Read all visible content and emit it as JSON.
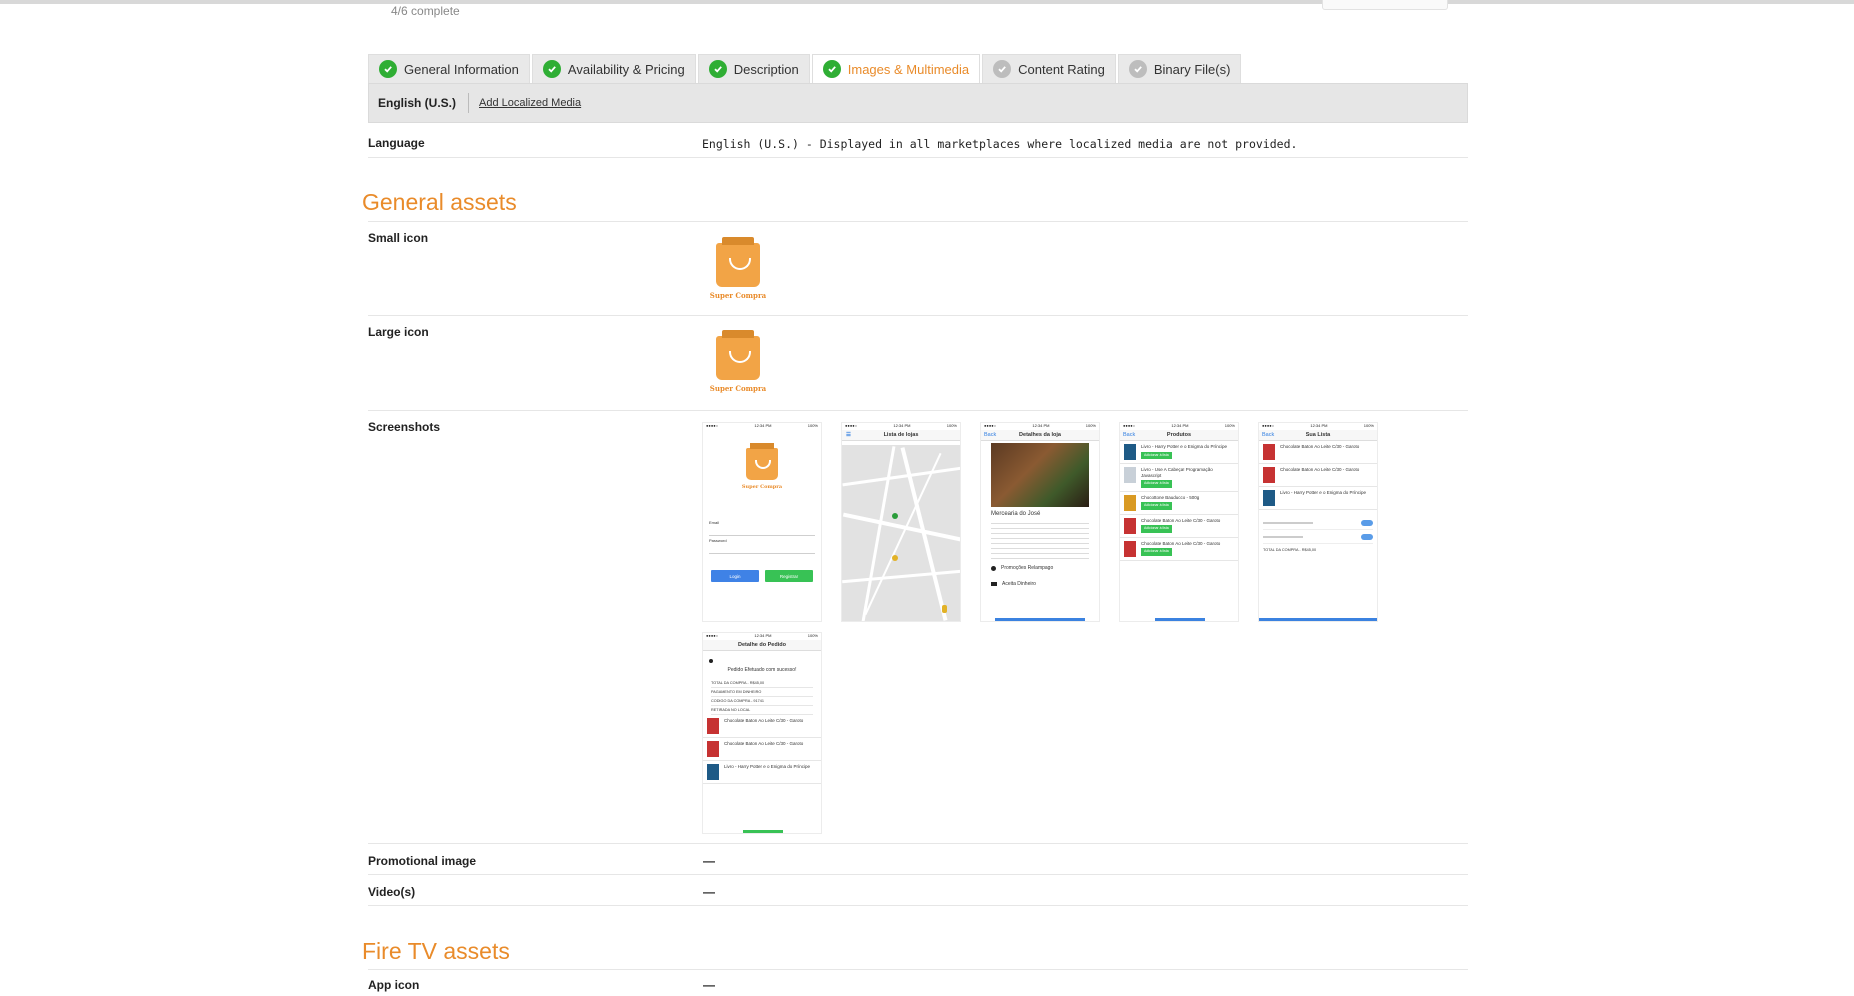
{
  "header": {
    "progress_text": "4/6 complete"
  },
  "tabs": [
    {
      "label": "General Information",
      "status": "complete"
    },
    {
      "label": "Availability & Pricing",
      "status": "complete"
    },
    {
      "label": "Description",
      "status": "complete"
    },
    {
      "label": "Images & Multimedia",
      "status": "complete",
      "active": true
    },
    {
      "label": "Content Rating",
      "status": "incomplete"
    },
    {
      "label": "Binary File(s)",
      "status": "incomplete"
    }
  ],
  "subbar": {
    "language_tab": "English (U.S.)",
    "add_localized_link": "Add Localized Media"
  },
  "language_row": {
    "label": "Language",
    "value": "English (U.S.) - Displayed in all marketplaces where localized media are not provided."
  },
  "general_assets": {
    "title": "General assets",
    "small_icon_label": "Small icon",
    "large_icon_label": "Large icon",
    "app_name": "Super Compra",
    "screenshots_label": "Screenshots",
    "promotional_label": "Promotional image",
    "promotional_value": "—",
    "videos_label": "Video(s)",
    "videos_value": "—"
  },
  "screens": {
    "login": {
      "email": "Email",
      "password": "Password",
      "login": "Login",
      "register": "Registrar"
    },
    "stores": {
      "title": "Lista de lojas"
    },
    "store_detail": {
      "title": "Detalhes da loja",
      "back": "Back",
      "store_name": "Mercearia do José",
      "promo": "Promoções Relampago",
      "cash": "Aceita Dinheiro"
    },
    "products": {
      "title": "Produtos",
      "back": "Back",
      "items": [
        "Livro - Harry Potter e o Enigma do Príncipe",
        "Livro - Use A Cabeça! Programação Javascript",
        "Chocottone Bauducco - 500g",
        "Chocolate Baton Ao Leite C/30 - Garoto",
        "Chocolate Baton Ao Leite C/30 - Garoto"
      ],
      "add_label": "Adicionar à lista"
    },
    "list": {
      "title": "Sua Lista",
      "back": "Back",
      "items": [
        "Chocolate Baton Ao Leite C/30 - Garoto",
        "Chocolate Baton Ao Leite C/30 - Garoto",
        "Livro - Harry Potter e o Enigma do Príncipe"
      ],
      "total": "TOTAL DA COMPRA - R$45,00"
    },
    "order": {
      "title": "Detalhe do Pedido",
      "success": "Pedido Efetuado com sucesso!",
      "lines": [
        "TOTAL DA COMPRA - R$45,00",
        "PAGAMENTO EM DINHEIRO",
        "CODIGO DA COMPRA - 91741",
        "RETIRADA NO LOCAL"
      ],
      "items": [
        "Chocolate Baton Ao Leite C/30 - Garoto",
        "Chocolate Baton Ao Leite C/30 - Garoto",
        "Livro - Harry Potter e o Enigma do Príncipe"
      ]
    }
  },
  "fire_tv": {
    "title": "Fire TV assets",
    "app_icon_label": "App icon",
    "app_icon_value": "—"
  },
  "colors": {
    "accent": "#e98b2a",
    "complete": "#2fae34",
    "incomplete": "#bdbdbd"
  }
}
